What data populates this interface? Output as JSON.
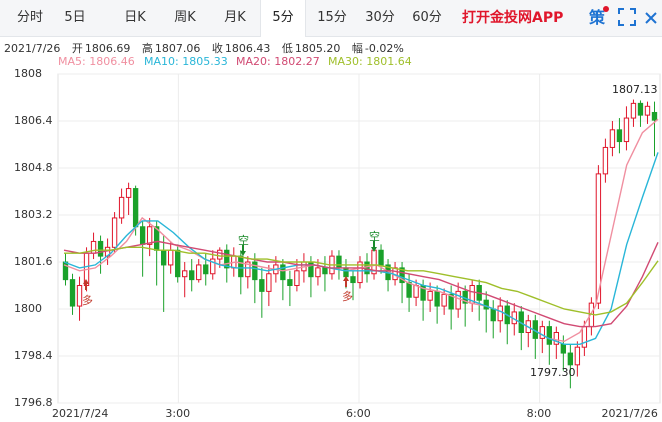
{
  "tabs": [
    {
      "label": "分时",
      "active": false
    },
    {
      "label": "5日",
      "active": false
    },
    {
      "label": "日K",
      "active": false
    },
    {
      "label": "周K",
      "active": false
    },
    {
      "label": "月K",
      "active": false
    },
    {
      "label": "5分",
      "active": true
    },
    {
      "label": "15分",
      "active": false
    },
    {
      "label": "30分",
      "active": false
    },
    {
      "label": "60分",
      "active": false
    }
  ],
  "brand": {
    "label": "打开金投网APP",
    "color": "#e0162b"
  },
  "toolbar": {
    "policy_icon_label": "策",
    "fullscreen_icon": "fullscreen-icon",
    "close_icon": "close-icon"
  },
  "quote": {
    "date": "2021/7/26",
    "open_label": "开",
    "open": "1806.69",
    "high_label": "高",
    "high": "1807.06",
    "close_label": "收",
    "close": "1806.43",
    "low_label": "低",
    "low": "1805.20",
    "change_label": "幅",
    "change": "-0.02%"
  },
  "moving_averages": [
    {
      "label": "MA5: 1806.46",
      "color": "#f08fa0"
    },
    {
      "label": "MA10: 1805.33",
      "color": "#29b6d8"
    },
    {
      "label": "MA20: 1802.27",
      "color": "#d14a73"
    },
    {
      "label": "MA30: 1801.64",
      "color": "#9fbf2a"
    }
  ],
  "chart_data": {
    "type": "candlestick",
    "ylim": [
      1796.8,
      1808.0
    ],
    "y_ticks": [
      "1808",
      "1806.4",
      "1804.8",
      "1803.2",
      "1801.6",
      "1800",
      "1798.4",
      "1796.8"
    ],
    "x_ticks": [
      "2021/7/24",
      "3:00",
      "6:00",
      "8:00",
      "2021/7/26"
    ],
    "x_tick_positions": [
      0,
      0.2,
      0.5,
      0.8,
      1.0
    ],
    "annotations": [
      {
        "text": "1807.13",
        "kind": "high"
      },
      {
        "text": "1797.30",
        "kind": "low"
      },
      {
        "text": "多",
        "kind": "signal"
      },
      {
        "text": "空",
        "kind": "signal"
      },
      {
        "text": "多",
        "kind": "signal"
      },
      {
        "text": "空",
        "kind": "signal"
      }
    ],
    "up_color": "#e0162b",
    "down_color": "#1aa12a",
    "candles": [
      [
        1801.6,
        1801.0,
        1801.9,
        1800.8
      ],
      [
        1801.0,
        1800.1,
        1801.2,
        1799.8
      ],
      [
        1800.1,
        1800.8,
        1801.1,
        1799.6
      ],
      [
        1800.8,
        1801.9,
        1802.1,
        1800.6
      ],
      [
        1801.9,
        1802.3,
        1802.6,
        1801.7
      ],
      [
        1802.3,
        1801.8,
        1802.5,
        1801.2
      ],
      [
        1801.8,
        1802.1,
        1802.4,
        1801.5
      ],
      [
        1802.1,
        1803.1,
        1803.3,
        1801.9
      ],
      [
        1803.1,
        1803.8,
        1804.1,
        1802.9
      ],
      [
        1803.8,
        1804.1,
        1804.3,
        1803.2
      ],
      [
        1804.1,
        1802.8,
        1804.2,
        1802.5
      ],
      [
        1802.8,
        1802.2,
        1803.0,
        1801.1
      ],
      [
        1802.2,
        1802.8,
        1803.1,
        1801.8
      ],
      [
        1802.8,
        1802.0,
        1803.0,
        1800.8
      ],
      [
        1802.0,
        1801.5,
        1802.5,
        1799.9
      ],
      [
        1801.5,
        1802.0,
        1802.3,
        1801.2
      ],
      [
        1802.0,
        1801.1,
        1802.2,
        1800.9
      ],
      [
        1801.1,
        1801.3,
        1801.6,
        1800.4
      ],
      [
        1801.3,
        1801.0,
        1801.7,
        1800.6
      ],
      [
        1801.0,
        1801.5,
        1801.7,
        1800.9
      ],
      [
        1801.5,
        1801.2,
        1801.9,
        1800.8
      ],
      [
        1801.2,
        1801.7,
        1802.0,
        1801.0
      ],
      [
        1801.7,
        1802.0,
        1802.1,
        1801.4
      ],
      [
        1802.0,
        1801.4,
        1802.2,
        1800.9
      ],
      [
        1801.4,
        1801.8,
        1802.1,
        1801.1
      ],
      [
        1801.8,
        1801.1,
        1802.0,
        1800.5
      ],
      [
        1801.1,
        1801.6,
        1801.8,
        1800.7
      ],
      [
        1801.6,
        1801.0,
        1801.9,
        1800.2
      ],
      [
        1801.0,
        1800.6,
        1801.4,
        1799.7
      ],
      [
        1800.6,
        1801.2,
        1801.5,
        1800.1
      ],
      [
        1801.2,
        1801.5,
        1801.8,
        1800.9
      ],
      [
        1801.5,
        1801.0,
        1801.7,
        1800.3
      ],
      [
        1801.0,
        1800.8,
        1801.3,
        1800.1
      ],
      [
        1800.8,
        1801.3,
        1801.7,
        1800.6
      ],
      [
        1801.3,
        1801.6,
        1801.9,
        1800.9
      ],
      [
        1801.6,
        1801.1,
        1801.8,
        1800.4
      ],
      [
        1801.1,
        1801.4,
        1801.7,
        1800.8
      ],
      [
        1801.4,
        1801.2,
        1801.8,
        1800.6
      ],
      [
        1801.2,
        1801.8,
        1802.0,
        1801.0
      ],
      [
        1801.8,
        1801.4,
        1802.0,
        1801.0
      ],
      [
        1801.4,
        1801.1,
        1801.7,
        1800.7
      ],
      [
        1801.1,
        1800.9,
        1801.3,
        1800.3
      ],
      [
        1800.9,
        1801.6,
        1801.8,
        1800.7
      ],
      [
        1801.6,
        1801.2,
        1801.9,
        1800.9
      ],
      [
        1801.2,
        1802.0,
        1802.3,
        1801.0
      ],
      [
        1802.0,
        1801.5,
        1802.2,
        1801.2
      ],
      [
        1801.5,
        1801.0,
        1801.7,
        1800.6
      ],
      [
        1801.0,
        1801.4,
        1801.6,
        1800.8
      ],
      [
        1801.4,
        1800.9,
        1801.6,
        1800.2
      ],
      [
        1800.9,
        1800.4,
        1801.2,
        1799.9
      ],
      [
        1800.4,
        1800.8,
        1801.0,
        1800.1
      ],
      [
        1800.8,
        1800.3,
        1801.0,
        1799.6
      ],
      [
        1800.3,
        1800.6,
        1800.9,
        1799.9
      ],
      [
        1800.6,
        1800.1,
        1800.8,
        1799.5
      ],
      [
        1800.1,
        1800.5,
        1800.7,
        1799.8
      ],
      [
        1800.5,
        1800.0,
        1800.8,
        1799.3
      ],
      [
        1800.0,
        1800.6,
        1800.9,
        1799.7
      ],
      [
        1800.6,
        1800.2,
        1800.8,
        1799.4
      ],
      [
        1800.2,
        1800.8,
        1801.0,
        1799.9
      ],
      [
        1800.8,
        1800.3,
        1801.0,
        1799.6
      ],
      [
        1800.3,
        1800.0,
        1800.6,
        1799.2
      ],
      [
        1800.0,
        1799.6,
        1800.3,
        1799.0
      ],
      [
        1799.6,
        1800.1,
        1800.4,
        1799.2
      ],
      [
        1800.1,
        1799.5,
        1800.3,
        1798.8
      ],
      [
        1799.5,
        1799.9,
        1800.2,
        1799.1
      ],
      [
        1799.9,
        1799.2,
        1800.1,
        1798.6
      ],
      [
        1799.2,
        1799.6,
        1799.8,
        1798.7
      ],
      [
        1799.6,
        1799.0,
        1799.8,
        1798.3
      ],
      [
        1799.0,
        1799.4,
        1799.6,
        1798.5
      ],
      [
        1799.4,
        1798.8,
        1799.6,
        1798.1
      ],
      [
        1798.8,
        1799.2,
        1799.4,
        1798.3
      ],
      [
        1798.8,
        1798.5,
        1799.1,
        1797.9
      ],
      [
        1798.5,
        1798.1,
        1798.8,
        1797.3
      ],
      [
        1798.1,
        1798.7,
        1798.9,
        1797.7
      ],
      [
        1798.7,
        1799.4,
        1799.6,
        1798.4
      ],
      [
        1799.4,
        1800.2,
        1800.4,
        1799.1
      ],
      [
        1800.2,
        1804.6,
        1804.9,
        1800.0
      ],
      [
        1804.6,
        1805.5,
        1805.8,
        1804.3
      ],
      [
        1805.5,
        1806.1,
        1806.4,
        1805.2
      ],
      [
        1806.1,
        1805.7,
        1806.5,
        1805.3
      ],
      [
        1805.7,
        1806.5,
        1806.9,
        1805.4
      ],
      [
        1806.5,
        1807.0,
        1807.13,
        1806.2
      ],
      [
        1807.0,
        1806.6,
        1807.1,
        1806.2
      ],
      [
        1806.6,
        1806.9,
        1807.06,
        1806.3
      ],
      [
        1806.69,
        1806.43,
        1807.06,
        1805.2
      ]
    ],
    "series": [
      {
        "name": "MA5",
        "color": "#f08fa0",
        "values": [
          1801.5,
          1801.3,
          1801.4,
          1801.8,
          1802.3,
          1803.1,
          1802.7,
          1802.2,
          1802.0,
          1801.7,
          1801.5,
          1801.6,
          1801.5,
          1801.4,
          1801.3,
          1801.4,
          1801.5,
          1801.4,
          1801.3,
          1801.4,
          1801.5,
          1801.2,
          1800.9,
          1800.7,
          1800.6,
          1800.4,
          1800.2,
          1800.1,
          1799.9,
          1799.6,
          1799.3,
          1799.0,
          1798.9,
          1799.2,
          1800.1,
          1802.5,
          1804.9,
          1806.0,
          1806.46
        ]
      },
      {
        "name": "MA10",
        "color": "#29b6d8",
        "values": [
          1801.6,
          1801.4,
          1801.5,
          1801.9,
          1802.5,
          1803.0,
          1803.0,
          1802.6,
          1802.1,
          1801.7,
          1801.5,
          1801.4,
          1801.4,
          1801.3,
          1801.4,
          1801.5,
          1801.5,
          1801.4,
          1801.3,
          1801.3,
          1801.3,
          1801.2,
          1801.0,
          1800.8,
          1800.7,
          1800.5,
          1800.3,
          1800.1,
          1799.9,
          1799.6,
          1799.3,
          1799.0,
          1798.8,
          1798.8,
          1799.0,
          1800.0,
          1802.2,
          1803.8,
          1805.33
        ]
      },
      {
        "name": "MA20",
        "color": "#d14a73",
        "values": [
          1802.0,
          1801.9,
          1801.9,
          1802.0,
          1802.1,
          1802.2,
          1802.3,
          1802.2,
          1802.1,
          1802.0,
          1801.9,
          1801.8,
          1801.7,
          1801.6,
          1801.6,
          1801.5,
          1801.5,
          1801.4,
          1801.4,
          1801.4,
          1801.3,
          1801.3,
          1801.2,
          1801.1,
          1801.0,
          1800.8,
          1800.6,
          1800.5,
          1800.3,
          1800.1,
          1799.9,
          1799.7,
          1799.5,
          1799.4,
          1799.4,
          1799.5,
          1800.1,
          1801.1,
          1802.27
        ]
      },
      {
        "name": "MA30",
        "color": "#9fbf2a",
        "values": [
          1801.9,
          1801.9,
          1802.0,
          1802.0,
          1802.1,
          1802.1,
          1802.0,
          1802.0,
          1801.9,
          1801.9,
          1801.8,
          1801.8,
          1801.7,
          1801.7,
          1801.6,
          1801.6,
          1801.6,
          1801.5,
          1801.5,
          1801.5,
          1801.5,
          1801.4,
          1801.3,
          1801.3,
          1801.2,
          1801.1,
          1801.0,
          1800.9,
          1800.7,
          1800.6,
          1800.4,
          1800.2,
          1800.0,
          1799.9,
          1799.8,
          1799.9,
          1800.2,
          1800.9,
          1801.64
        ]
      }
    ]
  }
}
